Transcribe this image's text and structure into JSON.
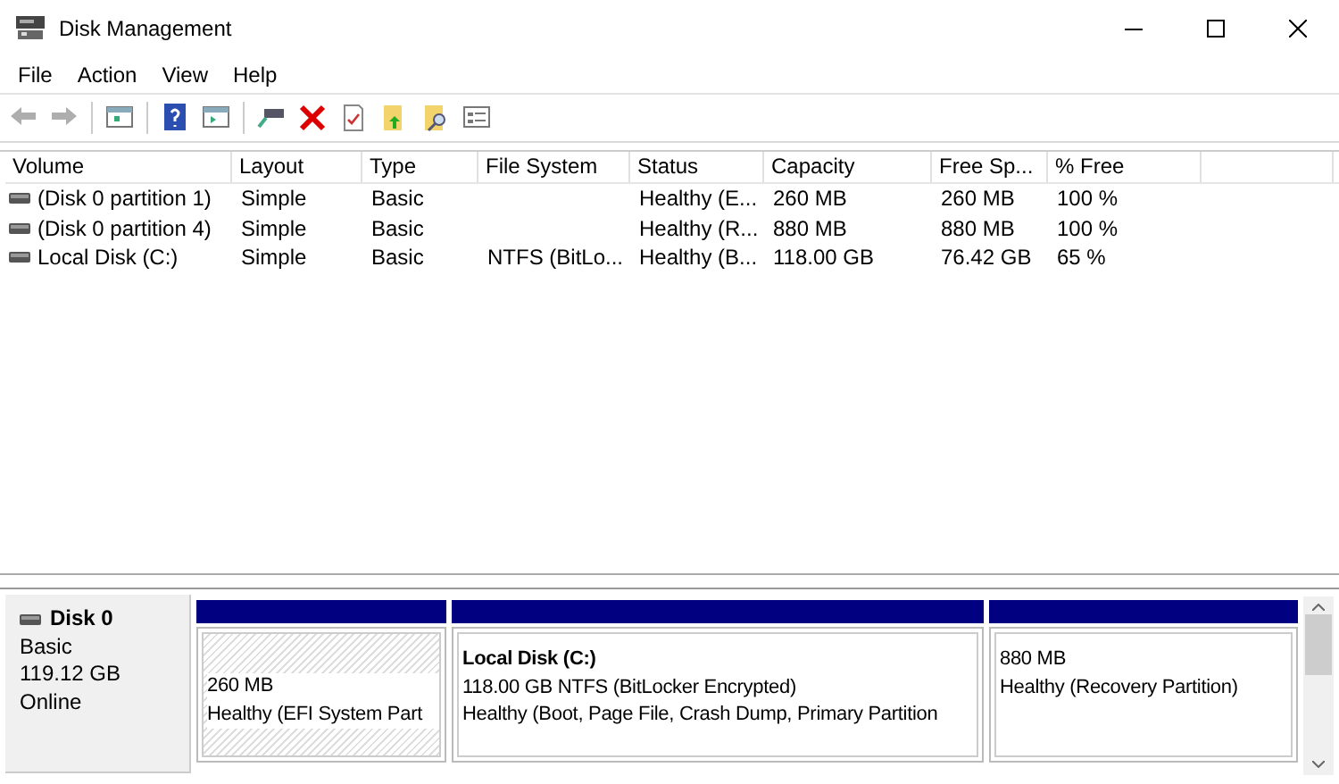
{
  "window": {
    "title": "Disk Management"
  },
  "menu": [
    "File",
    "Action",
    "View",
    "Help"
  ],
  "toolbar": [
    {
      "kind": "back",
      "disabled": true
    },
    {
      "kind": "forward",
      "disabled": true
    },
    {
      "kind": "sep"
    },
    {
      "kind": "tree",
      "disabled": false
    },
    {
      "kind": "sep"
    },
    {
      "kind": "help",
      "disabled": false
    },
    {
      "kind": "pane",
      "disabled": false
    },
    {
      "kind": "sep"
    },
    {
      "kind": "connect",
      "disabled": false
    },
    {
      "kind": "delete",
      "disabled": false
    },
    {
      "kind": "properties",
      "disabled": false
    },
    {
      "kind": "folder-up",
      "disabled": false
    },
    {
      "kind": "folder-search",
      "disabled": false
    },
    {
      "kind": "list",
      "disabled": false
    }
  ],
  "table": {
    "columns": [
      "Volume",
      "Layout",
      "Type",
      "File System",
      "Status",
      "Capacity",
      "Free Sp...",
      "% Free"
    ],
    "rows": [
      [
        "(Disk 0 partition 1)",
        "Simple",
        "Basic",
        "",
        "Healthy (E...",
        "260 MB",
        "260 MB",
        "100 %"
      ],
      [
        "(Disk 0 partition 4)",
        "Simple",
        "Basic",
        "",
        "Healthy (R...",
        "880 MB",
        "880 MB",
        "100 %"
      ],
      [
        "Local Disk (C:)",
        "Simple",
        "Basic",
        "NTFS (BitLo...",
        "Healthy (B...",
        "118.00 GB",
        "76.42 GB",
        "65 %"
      ]
    ]
  },
  "disks": [
    {
      "name": "Disk 0",
      "type": "Basic",
      "size": "119.12 GB",
      "state": "Online",
      "partitions": [
        {
          "selected": true,
          "size": "260 MB",
          "status": "Healthy (EFI System Part"
        },
        {
          "selected": false,
          "name": "Local Disk  (C:)",
          "size": "118.00 GB NTFS (BitLocker Encrypted)",
          "status": "Healthy (Boot, Page File, Crash Dump, Primary Partition"
        },
        {
          "selected": false,
          "size": "880 MB",
          "status": "Healthy (Recovery Partition)"
        }
      ]
    }
  ]
}
